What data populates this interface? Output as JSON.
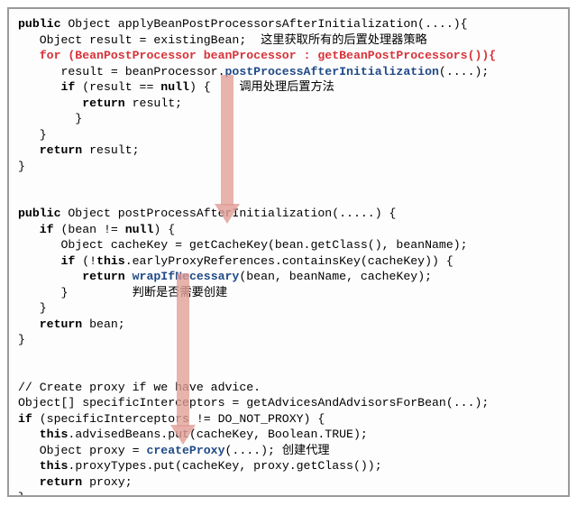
{
  "block1": {
    "l1a": "public",
    "l1b": " Object applyBeanPostProcessorsAfterInitialization(....){",
    "l2": "   Object result = existingBean;  ",
    "l2n": "这里获取所有的后置处理器策略",
    "l3": "   for (BeanPostProcessor beanProcessor : getBeanPostProcessors()){",
    "l4a": "      result = beanProcessor.",
    "l4b": "postProcessAfterInitialization",
    "l4c": "(....);",
    "l5a": "      if",
    "l5b": " (result == ",
    "l5c": "null",
    "l5d": ") {",
    "l5n": "    调用处理后置方法",
    "l6a": "         return",
    "l6b": " result;",
    "l7": "        }",
    "l8": "   }",
    "l9a": "   return",
    "l9b": " result;",
    "l10": "}"
  },
  "block2": {
    "l1a": "public",
    "l1b": " Object postProcessAfterInitialization(.....) {",
    "l2a": "   if",
    "l2b": " (bean != ",
    "l2c": "null",
    "l2d": ") {",
    "l3": "      Object cacheKey = getCacheKey(bean.getClass(), beanName);",
    "l4a": "      if",
    "l4b": " (!",
    "l4c": "this",
    "l4d": ".earlyProxyReferences.containsKey(cacheKey)) {",
    "l5a": "         return",
    "l5b": " ",
    "l5c": "wrapIfNecessary",
    "l5d": "(bean, beanName, cacheKey);",
    "l6": "      }",
    "l6n": "         判断是否需要创建",
    "l7": "   }",
    "l8a": "   return",
    "l8b": " bean;",
    "l9": "}"
  },
  "block3": {
    "l1": "// Create proxy if we have advice.",
    "l2": "Object[] specificInterceptors = getAdvicesAndAdvisorsForBean(...);",
    "l3a": "if",
    "l3b": " (specificInterceptors != DO_NOT_PROXY) {",
    "l4a": "   this",
    "l4b": ".advisedBeans.put(cacheKey, Boolean.TRUE);",
    "l5a": "   Object proxy = ",
    "l5b": "createProxy",
    "l5c": "(....); ",
    "l5n": "创建代理",
    "l6a": "   this",
    "l6b": ".proxyTypes.put(cacheKey, proxy.getClass());",
    "l7a": "   return",
    "l7b": " proxy;",
    "l8": "}"
  }
}
